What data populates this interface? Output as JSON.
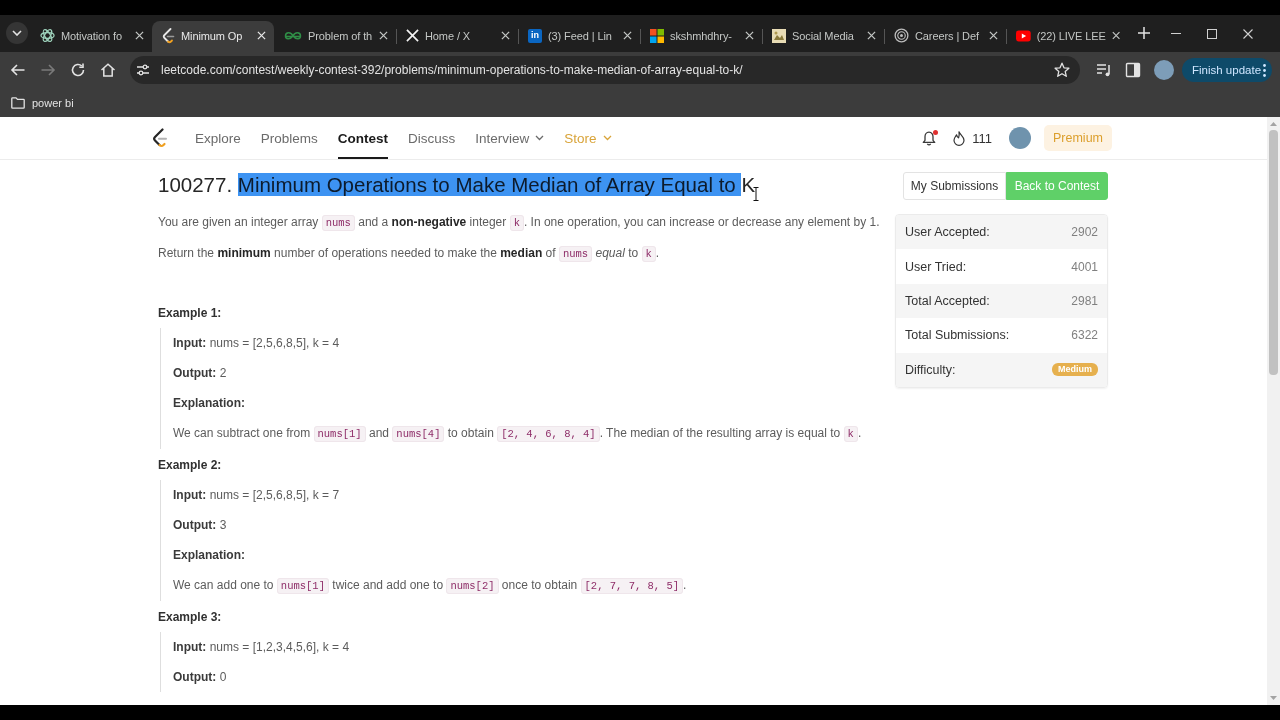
{
  "browser": {
    "tabs": [
      {
        "title": "Motivation fo",
        "selected": false
      },
      {
        "title": "Minimum Op",
        "selected": true
      },
      {
        "title": "Problem of th",
        "selected": false
      },
      {
        "title": "Home / X",
        "selected": false
      },
      {
        "title": "(3) Feed | Lin",
        "badge": "in",
        "selected": false
      },
      {
        "title": "skshmhdhry-",
        "selected": false
      },
      {
        "title": "Social Media",
        "selected": false
      },
      {
        "title": "Careers | Def",
        "selected": false
      },
      {
        "title": "(22) LIVE LEE",
        "selected": false
      }
    ],
    "forward_disabled": true,
    "url": "leetcode.com/contest/weekly-contest-392/problems/minimum-operations-to-make-median-of-array-equal-to-k/",
    "update_button": "Finish update",
    "bookmarks": [
      {
        "label": "power bi"
      }
    ]
  },
  "site_nav": {
    "items": [
      {
        "label": "Explore",
        "selected": false,
        "dropdown": false
      },
      {
        "label": "Problems",
        "selected": false,
        "dropdown": false
      },
      {
        "label": "Contest",
        "selected": true,
        "dropdown": false
      },
      {
        "label": "Discuss",
        "selected": false,
        "dropdown": false
      },
      {
        "label": "Interview",
        "selected": false,
        "dropdown": true
      },
      {
        "label": "Store",
        "selected": false,
        "dropdown": true,
        "color": "#d9a43a"
      }
    ],
    "unread_notifications": true,
    "streak": "111",
    "premium": "Premium"
  },
  "problem": {
    "title_parts": [
      {
        "text": "100277. ",
        "selected": false
      },
      {
        "text": "Minimum Operations to Make Median of Array Equal to ",
        "selected": true
      },
      {
        "text": "K",
        "selected": false
      }
    ],
    "description": [
      [
        {
          "kind": "text",
          "text": "You are given an integer array "
        },
        {
          "kind": "code",
          "text": "nums"
        },
        {
          "kind": "text",
          "text": " and a **non-negative** integer "
        },
        {
          "kind": "code",
          "text": "k"
        },
        {
          "kind": "text",
          "text": ". In one operation, you can increase or decrease any element by 1."
        }
      ],
      [
        {
          "kind": "text",
          "text": "Return the **minimum** number of operations needed to make the **median** of "
        },
        {
          "kind": "code",
          "text": "nums"
        },
        {
          "kind": "text",
          "text": " *equal* to "
        },
        {
          "kind": "code",
          "text": "k"
        },
        {
          "kind": "text",
          "text": "."
        }
      ]
    ],
    "examples": [
      {
        "title": "Example 1:",
        "lines": [
          {
            "kind": "field",
            "label": "Input:",
            "value": "nums = [2,5,6,8,5], k = 4"
          },
          {
            "kind": "field",
            "label": "Output:",
            "value": "2"
          },
          {
            "kind": "heading",
            "label": "Explanation:"
          },
          {
            "kind": "runs",
            "runs": [
              {
                "kind": "text",
                "text": "We can subtract one from "
              },
              {
                "kind": "code",
                "text": "nums[1]"
              },
              {
                "kind": "text",
                "text": " and "
              },
              {
                "kind": "code",
                "text": "nums[4]"
              },
              {
                "kind": "text",
                "text": " to obtain "
              },
              {
                "kind": "code",
                "text": "[2, 4, 6, 8, 4]"
              },
              {
                "kind": "text",
                "text": ". The median of the resulting array is equal to "
              },
              {
                "kind": "code",
                "text": "k"
              },
              {
                "kind": "text",
                "text": "."
              }
            ]
          }
        ]
      },
      {
        "title": "Example 2:",
        "lines": [
          {
            "kind": "field",
            "label": "Input:",
            "value": "nums = [2,5,6,8,5], k = 7"
          },
          {
            "kind": "field",
            "label": "Output:",
            "value": "3"
          },
          {
            "kind": "heading",
            "label": "Explanation:"
          },
          {
            "kind": "runs",
            "runs": [
              {
                "kind": "text",
                "text": "We can add one to "
              },
              {
                "kind": "code",
                "text": "nums[1]"
              },
              {
                "kind": "text",
                "text": " twice and add one to "
              },
              {
                "kind": "code",
                "text": "nums[2]"
              },
              {
                "kind": "text",
                "text": " once to obtain "
              },
              {
                "kind": "code",
                "text": "[2, 7, 7, 8, 5]"
              },
              {
                "kind": "text",
                "text": "."
              }
            ]
          }
        ]
      },
      {
        "title": "Example 3:",
        "lines": [
          {
            "kind": "field",
            "label": "Input:",
            "value": "nums = [1,2,3,4,5,6], k = 4"
          },
          {
            "kind": "field",
            "label": "Output:",
            "value": "0"
          }
        ]
      }
    ]
  },
  "actions": [
    {
      "label": "My Submissions",
      "kind": "secondary"
    },
    {
      "label": "Back to Contest",
      "kind": "primary"
    }
  ],
  "stats": [
    {
      "label": "User Accepted:",
      "value": "2902",
      "kind": "number"
    },
    {
      "label": "User Tried:",
      "value": "4001",
      "kind": "number"
    },
    {
      "label": "Total Accepted:",
      "value": "2981",
      "kind": "number"
    },
    {
      "label": "Total Submissions:",
      "value": "6322",
      "kind": "number"
    },
    {
      "label": "Difficulty:",
      "value": "Medium",
      "kind": "badge"
    }
  ]
}
